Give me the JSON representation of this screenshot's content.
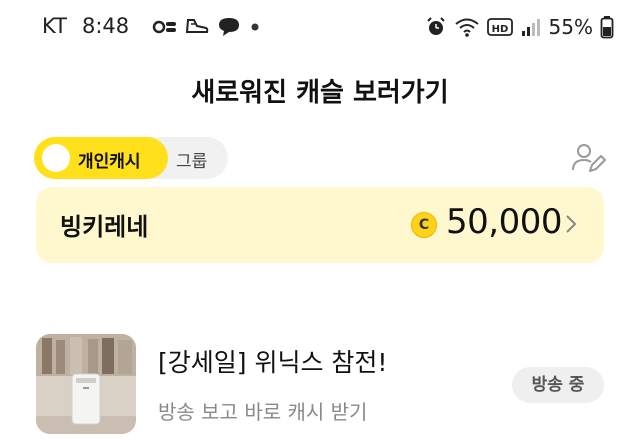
{
  "status_bar": {
    "carrier": "KT",
    "time": "8:48",
    "battery": "55%",
    "icons_left": [
      "settings-toggle-icon",
      "sneaker-icon",
      "chat-bubble-icon",
      "dot-icon"
    ],
    "icons_right": [
      "alarm-icon",
      "wifi-icon",
      "hd-icon",
      "signal-icon",
      "battery-icon"
    ]
  },
  "header": {
    "title": "새로워진 캐슬 보러가기"
  },
  "toggle": {
    "active_label": "개인캐시",
    "inactive_label": "그룹"
  },
  "card": {
    "name": "빙키레네",
    "amount": "50,000",
    "coin_symbol": "C"
  },
  "list": {
    "item": {
      "title": "[강세일] 위닉스 참전!",
      "subtitle": "방송 보고 바로 캐시 받기",
      "badge": "방송 중"
    }
  },
  "colors": {
    "accent": "#ffe01b",
    "card_bg": "#fff8cf",
    "toggle_bg": "#f1f1f1",
    "badge_bg": "#efefef"
  }
}
